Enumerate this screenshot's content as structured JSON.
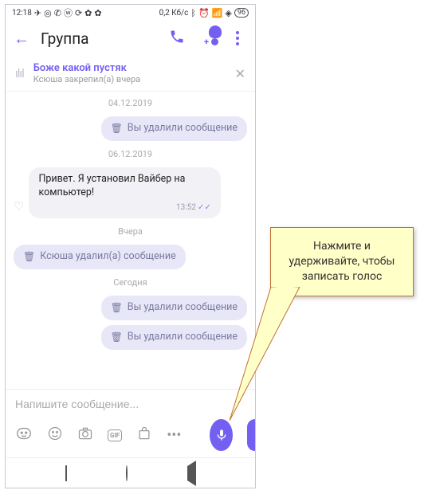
{
  "status": {
    "time": "12:18",
    "net_speed": "0,2 Кб/с",
    "battery": "96"
  },
  "header": {
    "title": "Группа"
  },
  "pinned": {
    "title": "Боже какой пустяк",
    "subtitle": "Ксюша закрепил(а) вчера"
  },
  "dates": {
    "d1": "04.12.2019",
    "d2": "06.12.2019",
    "d3": "Вчера",
    "d4": "Сегодня"
  },
  "messages": {
    "deleted_you": "Вы удалили сообщение",
    "deleted_other": "Ксюша удалил(а) сообщение",
    "incoming": "Привет. Я установил Вайбер на компьютер!",
    "incoming_time": "13:52"
  },
  "input": {
    "placeholder": "Напишите сообщение..."
  },
  "icons": {
    "gif": "GIF"
  },
  "callout": {
    "text": "Нажмите и удерживайте, чтобы записать голос"
  }
}
